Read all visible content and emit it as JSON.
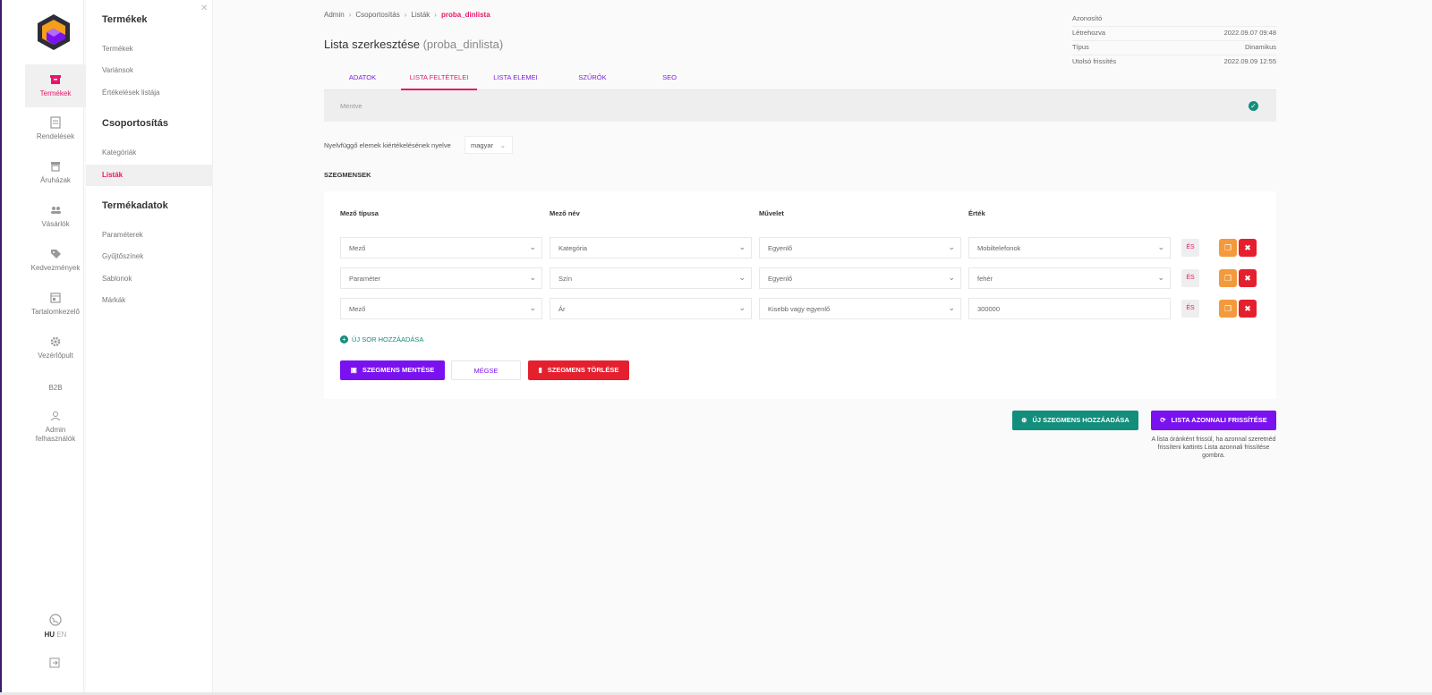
{
  "rail": {
    "items": [
      {
        "label": "Termékek",
        "icon": "box-icon"
      },
      {
        "label": "Rendelések",
        "icon": "receipt-icon"
      },
      {
        "label": "Áruházak",
        "icon": "store-icon"
      },
      {
        "label": "Vásárlók",
        "icon": "users-icon"
      },
      {
        "label": "Kedvezmények",
        "icon": "tag-icon"
      },
      {
        "label": "Tartalomkezelő",
        "icon": "content-icon"
      },
      {
        "label": "Vezérlőpult",
        "icon": "gear-icon"
      },
      {
        "label": "B2B"
      },
      {
        "label": "Admin felhasználók",
        "icon": "user-icon"
      }
    ],
    "lang_hu": "HU",
    "lang_en": "EN"
  },
  "subnav": {
    "group1": {
      "title": "Termékek",
      "items": [
        "Termékek",
        "Variánsok",
        "Értékelések listája"
      ]
    },
    "group2": {
      "title": "Csoportosítás",
      "items": [
        "Kategóriák",
        "Listák"
      ]
    },
    "group3": {
      "title": "Termékadatok",
      "items": [
        "Paraméterek",
        "Gyűjtőszínek",
        "Sablonok",
        "Márkák"
      ]
    }
  },
  "breadcrumb": {
    "items": [
      "Admin",
      "Csoportosítás",
      "Listák"
    ],
    "current": "proba_dinlista",
    "sep": "›"
  },
  "page": {
    "title": "Lista szerkesztése",
    "subtitle": "(proba_dinlista)"
  },
  "meta": {
    "rows": [
      {
        "label": "Azonosító",
        "value": ""
      },
      {
        "label": "Létrehozva",
        "value": "2022.09.07 09:48"
      },
      {
        "label": "Típus",
        "value": "Dinamikus"
      },
      {
        "label": "Utolsó frissítés",
        "value": "2022.09.09 12:55"
      }
    ]
  },
  "tabs": [
    "ADATOK",
    "LISTA FELTÉTELEI",
    "LISTA ELEMEI",
    "SZŰRŐK",
    "SEO"
  ],
  "status": {
    "text": "Mentve"
  },
  "language": {
    "label": "Nyelvfüggő elemek kiértékelésének nyelve",
    "value": "magyar"
  },
  "segments": {
    "label": "SZEGMENSEK",
    "columns": [
      "Mező típusa",
      "Mező név",
      "Művelet",
      "Érték"
    ],
    "rows": [
      {
        "type": "Mező",
        "name": "Kategória",
        "op": "Egyenlő",
        "value": "Mobiltelefonok",
        "and": "ÉS"
      },
      {
        "type": "Paraméter",
        "name": "Szín",
        "op": "Egyenlő",
        "value": "fehér",
        "and": "ÉS"
      },
      {
        "type": "Mező",
        "name": "Ár",
        "op": "Kisebb vagy egyenlő",
        "value": "300000",
        "and": "ÉS"
      }
    ],
    "add_row": "ÚJ SOR HOZZÁADÁSA",
    "save": "SZEGMENS MENTÉSE",
    "cancel": "MÉGSE",
    "delete": "SZEGMENS TÖRLÉSE"
  },
  "actions": {
    "new_segment": "ÚJ SZEGMENS HOZZÁADÁSA",
    "refresh": "LISTA AZONNALI FRISSÍTÉSE",
    "hint": "A lista óránként frissül, ha azonnal szeretnéd frissíteni kattints Lista azonnali frissítése gombra."
  },
  "colors": {
    "accent": "#e6186b",
    "primary": "#7a12f0",
    "teal": "#138e7c",
    "danger": "#e5202e",
    "orange": "#f39a3c"
  }
}
